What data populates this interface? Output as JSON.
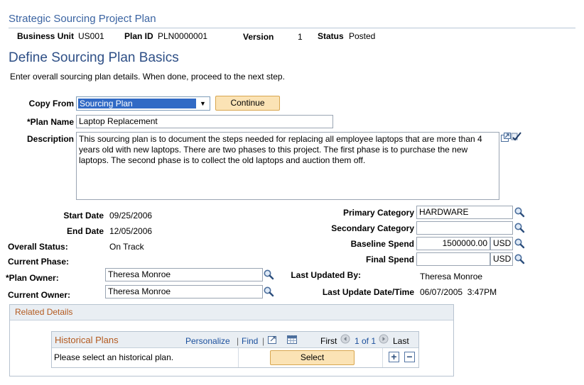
{
  "header": {
    "title": "Strategic Sourcing Project Plan",
    "business_unit_label": "Business Unit",
    "business_unit_value": "US001",
    "plan_id_label": "Plan ID",
    "plan_id_value": "PLN0000001",
    "version_label": "Version",
    "version_value": "1",
    "status_label": "Status",
    "status_value": "Posted"
  },
  "section": {
    "title": "Define Sourcing Plan Basics",
    "instructions": "Enter overall sourcing plan details.  When done, proceed to the next step."
  },
  "copy_from": {
    "label": "Copy From",
    "selected": "Sourcing Plan",
    "continue_label": "Continue"
  },
  "plan_name": {
    "label": "*Plan Name",
    "value": "Laptop Replacement"
  },
  "description": {
    "label": "Description",
    "value": "This sourcing plan is to document the steps needed for replacing all employee laptops that are more than 4 years old with new laptops.  There are two phases to this project.  The first phase is to  purchase the new laptops.  The second phase is to collect the old laptops and auction them off."
  },
  "dates": {
    "start_label": "Start Date",
    "start_value": "09/25/2006",
    "end_label": "End Date",
    "end_value": "12/05/2006"
  },
  "status": {
    "overall_label": "Overall Status:",
    "overall_value": "On Track",
    "phase_label": "Current Phase:",
    "phase_value": ""
  },
  "owners": {
    "plan_owner_label": "*Plan Owner:",
    "plan_owner_value": "Theresa Monroe",
    "current_owner_label": "Current Owner:",
    "current_owner_value": "Theresa Monroe"
  },
  "categories": {
    "primary_label": "Primary Category",
    "primary_value": "HARDWARE",
    "secondary_label": "Secondary Category",
    "secondary_value": ""
  },
  "spend": {
    "baseline_label": "Baseline Spend",
    "baseline_value": "1500000.00",
    "baseline_currency": "USD",
    "final_label": "Final Spend",
    "final_value": "",
    "final_currency": "USD"
  },
  "updated": {
    "by_label": "Last Updated By:",
    "by_value": "Theresa Monroe",
    "datetime_label": "Last Update Date/Time",
    "datetime_value": "06/07/2005  3:47PM"
  },
  "related": {
    "title": "Related Details",
    "grid": {
      "title": "Historical Plans",
      "personalize": "Personalize",
      "find": "Find",
      "sep1": "|",
      "sep2": "|",
      "first": "First",
      "range": "1 of 1",
      "last": "Last",
      "row_text": "Please select an historical plan.",
      "select_label": "Select",
      "add_symbol": "+",
      "remove_symbol": "−"
    }
  },
  "icons": {
    "lookup": "magnifier-icon",
    "expand": "expand-textarea-icon",
    "spellcheck": "spellcheck-icon",
    "view_all": "view-all-icon",
    "download": "grid-download-icon",
    "prev": "arrow-left-icon",
    "next": "arrow-right-icon"
  },
  "colors": {
    "title_blue": "#3b64a2",
    "section_blue": "#2e4f86",
    "button_fill": "#fbe3b5",
    "related_title": "#b35a1f",
    "link": "#1a4f9c"
  }
}
